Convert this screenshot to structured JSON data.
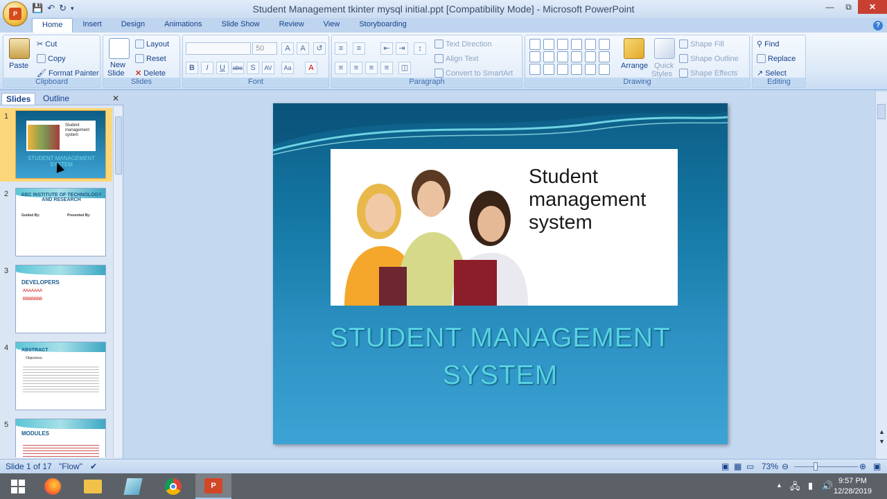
{
  "window": {
    "title": "Student Management tkinter mysql initial.ppt [Compatibility Mode] - Microsoft PowerPoint"
  },
  "tabs": [
    "Home",
    "Insert",
    "Design",
    "Animations",
    "Slide Show",
    "Review",
    "View",
    "Storyboarding"
  ],
  "ribbon": {
    "clipboard": {
      "label": "Clipboard",
      "paste": "Paste",
      "cut": "Cut",
      "copy": "Copy",
      "format_painter": "Format Painter"
    },
    "slides": {
      "label": "Slides",
      "new_slide_line1": "New",
      "new_slide_line2": "Slide",
      "layout": "Layout",
      "reset": "Reset",
      "delete": "Delete"
    },
    "font": {
      "label": "Font",
      "font_size": "50"
    },
    "paragraph": {
      "label": "Paragraph",
      "text_direction": "Text Direction",
      "align_text": "Align Text",
      "convert_smartart": "Convert to SmartArt"
    },
    "drawing": {
      "label": "Drawing",
      "arrange": "Arrange",
      "quick_styles_line1": "Quick",
      "quick_styles_line2": "Styles",
      "shape_fill": "Shape Fill",
      "shape_outline": "Shape Outline",
      "shape_effects": "Shape Effects"
    },
    "editing": {
      "label": "Editing",
      "find": "Find",
      "replace": "Replace",
      "select": "Select"
    }
  },
  "panel": {
    "tab_slides": "Slides",
    "tab_outline": "Outline",
    "thumbnails": [
      {
        "num": "1",
        "title": "STUDENT MANAGEMENT SYSTEM",
        "caption": "Student management system"
      },
      {
        "num": "2",
        "title": "ABC INSTITUTE OF TECHNOLOGY AND RESEARCH",
        "guided": "Guided By:",
        "presented": "Presented By:"
      },
      {
        "num": "3",
        "title": "DEVELOPERS",
        "line1": "AAAAAAA",
        "line2": "BBBBBBB"
      },
      {
        "num": "4",
        "title": "ABSTRACT",
        "sub": "Objectives:"
      },
      {
        "num": "5",
        "title": "MODULES"
      }
    ]
  },
  "slide": {
    "image_caption_line1": "Student",
    "image_caption_line2": "management",
    "image_caption_line3": "system",
    "title_line1": "STUDENT MANAGEMENT",
    "title_line2": "SYSTEM"
  },
  "status": {
    "slide_info": "Slide 1 of 17",
    "theme": "\"Flow\"",
    "zoom": "73%"
  },
  "taskbar": {
    "time": "9:57 PM",
    "date": "12/28/2019"
  }
}
